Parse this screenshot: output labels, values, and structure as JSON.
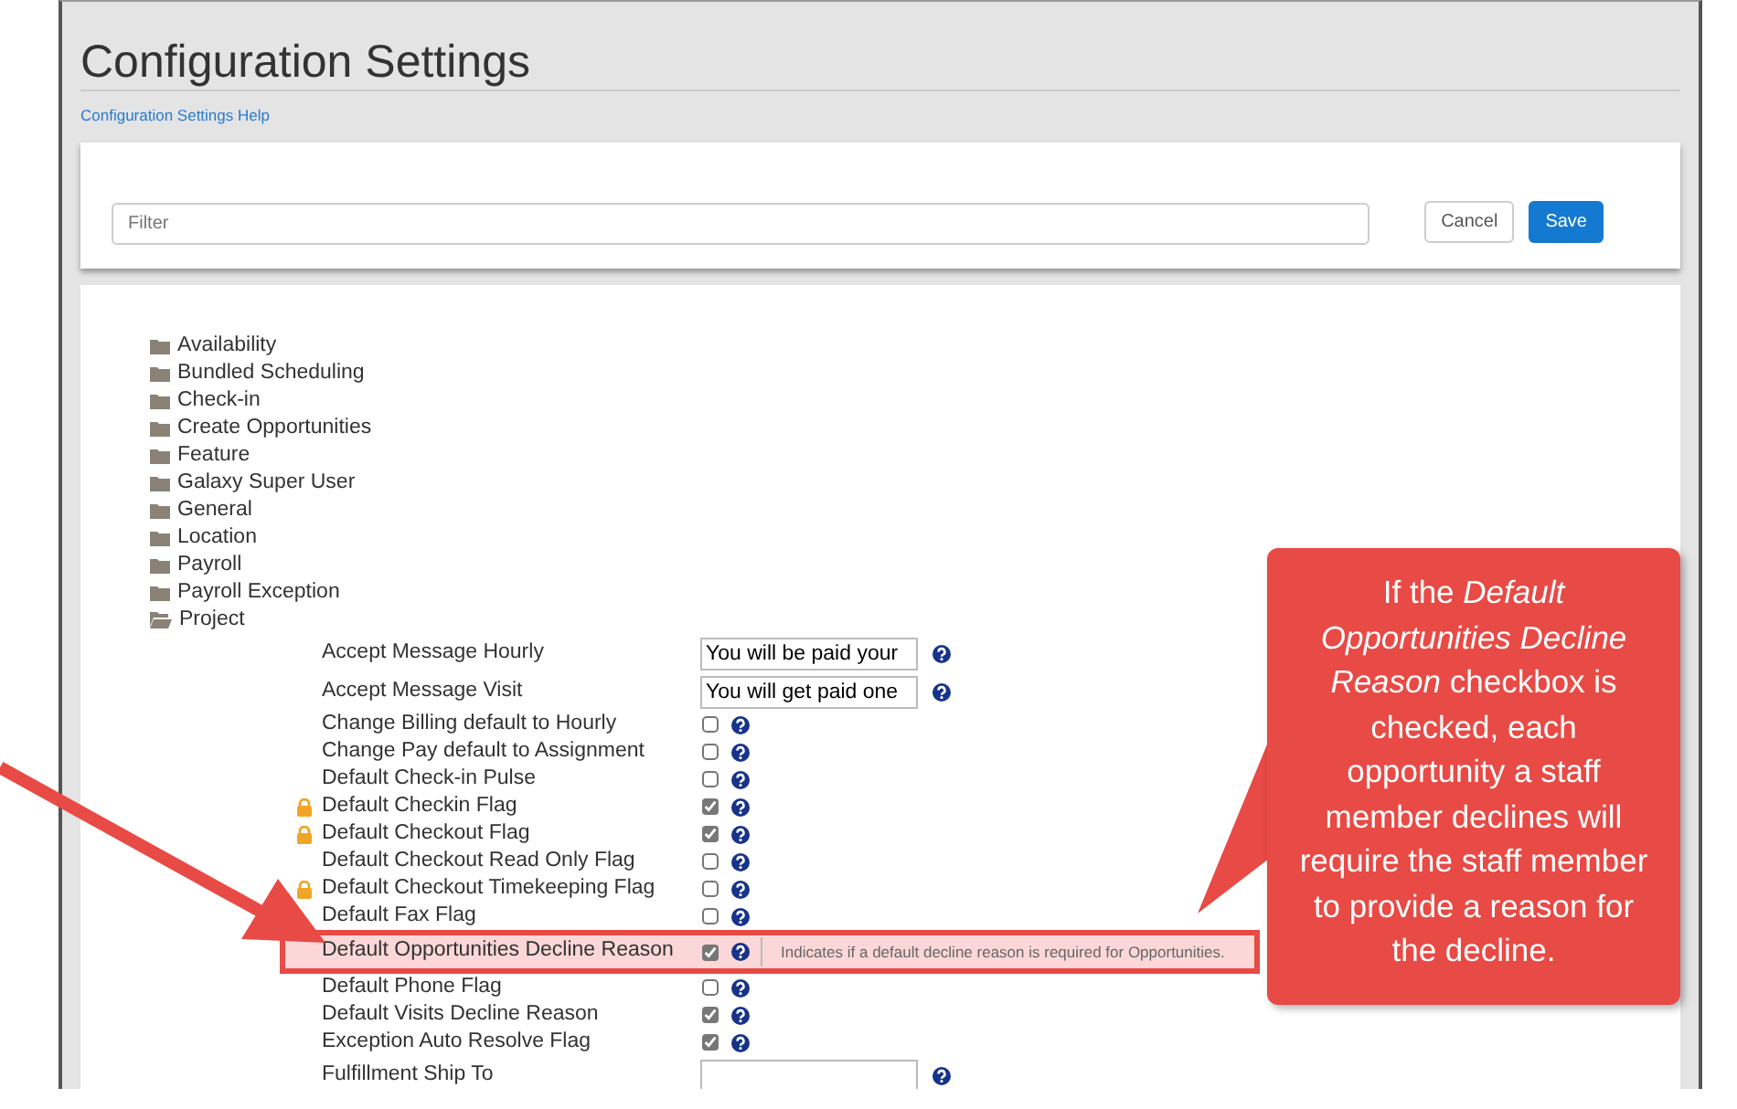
{
  "page": {
    "title": "Configuration Settings",
    "help_link": "Configuration Settings Help"
  },
  "filter": {
    "placeholder": "Filter"
  },
  "buttons": [
    {
      "label": "Cancel",
      "kind": "secondary"
    },
    {
      "label": "Save",
      "kind": "primary"
    }
  ],
  "tree": [
    {
      "label": "Availability",
      "expanded": false
    },
    {
      "label": "Bundled Scheduling",
      "expanded": false
    },
    {
      "label": "Check-in",
      "expanded": false
    },
    {
      "label": "Create Opportunities",
      "expanded": false
    },
    {
      "label": "Feature",
      "expanded": false
    },
    {
      "label": "Galaxy Super User",
      "expanded": false
    },
    {
      "label": "General",
      "expanded": false
    },
    {
      "label": "Location",
      "expanded": false
    },
    {
      "label": "Payroll",
      "expanded": false
    },
    {
      "label": "Payroll Exception",
      "expanded": false
    },
    {
      "label": "Project",
      "expanded": true,
      "settings": [
        {
          "label": "Accept Message Hourly",
          "locked": false,
          "kind": "text",
          "value": "You will be paid your",
          "highlighted": false
        },
        {
          "label": "Accept Message Visit",
          "locked": false,
          "kind": "text",
          "value": "You will get paid one",
          "highlighted": false
        },
        {
          "label": "Change Billing default to Hourly",
          "locked": false,
          "kind": "checkbox",
          "checked": false,
          "highlighted": false
        },
        {
          "label": "Change Pay default to Assignment",
          "locked": false,
          "kind": "checkbox",
          "checked": false,
          "highlighted": false
        },
        {
          "label": "Default Check-in Pulse",
          "locked": false,
          "kind": "checkbox",
          "checked": false,
          "highlighted": false
        },
        {
          "label": "Default Checkin Flag",
          "locked": true,
          "kind": "checkbox",
          "checked": true,
          "highlighted": false
        },
        {
          "label": "Default Checkout Flag",
          "locked": true,
          "kind": "checkbox",
          "checked": true,
          "highlighted": false
        },
        {
          "label": "Default Checkout Read Only Flag",
          "locked": false,
          "kind": "checkbox",
          "checked": false,
          "highlighted": false
        },
        {
          "label": "Default Checkout Timekeeping Flag",
          "locked": true,
          "kind": "checkbox",
          "checked": false,
          "highlighted": false
        },
        {
          "label": "Default Fax Flag",
          "locked": false,
          "kind": "checkbox",
          "checked": false,
          "highlighted": false
        },
        {
          "label": "Default Opportunities Decline Reason",
          "locked": false,
          "kind": "checkbox",
          "checked": true,
          "highlighted": true,
          "tooltip": "Indicates if a default decline reason is required for Opportunities."
        },
        {
          "label": "Default Phone Flag",
          "locked": false,
          "kind": "checkbox",
          "checked": false,
          "highlighted": false
        },
        {
          "label": "Default Visits Decline Reason",
          "locked": false,
          "kind": "checkbox",
          "checked": true,
          "highlighted": false
        },
        {
          "label": "Exception Auto Resolve Flag",
          "locked": false,
          "kind": "checkbox",
          "checked": true,
          "highlighted": false
        },
        {
          "label": "Fulfillment Ship To",
          "locked": false,
          "kind": "text",
          "highlighted": false
        }
      ]
    }
  ],
  "callout": {
    "text": "If the *Default Opportunities Decline Reason* checkbox is checked, each opportunity a staff member declines will require the staff member to provide a reason for the decline."
  }
}
